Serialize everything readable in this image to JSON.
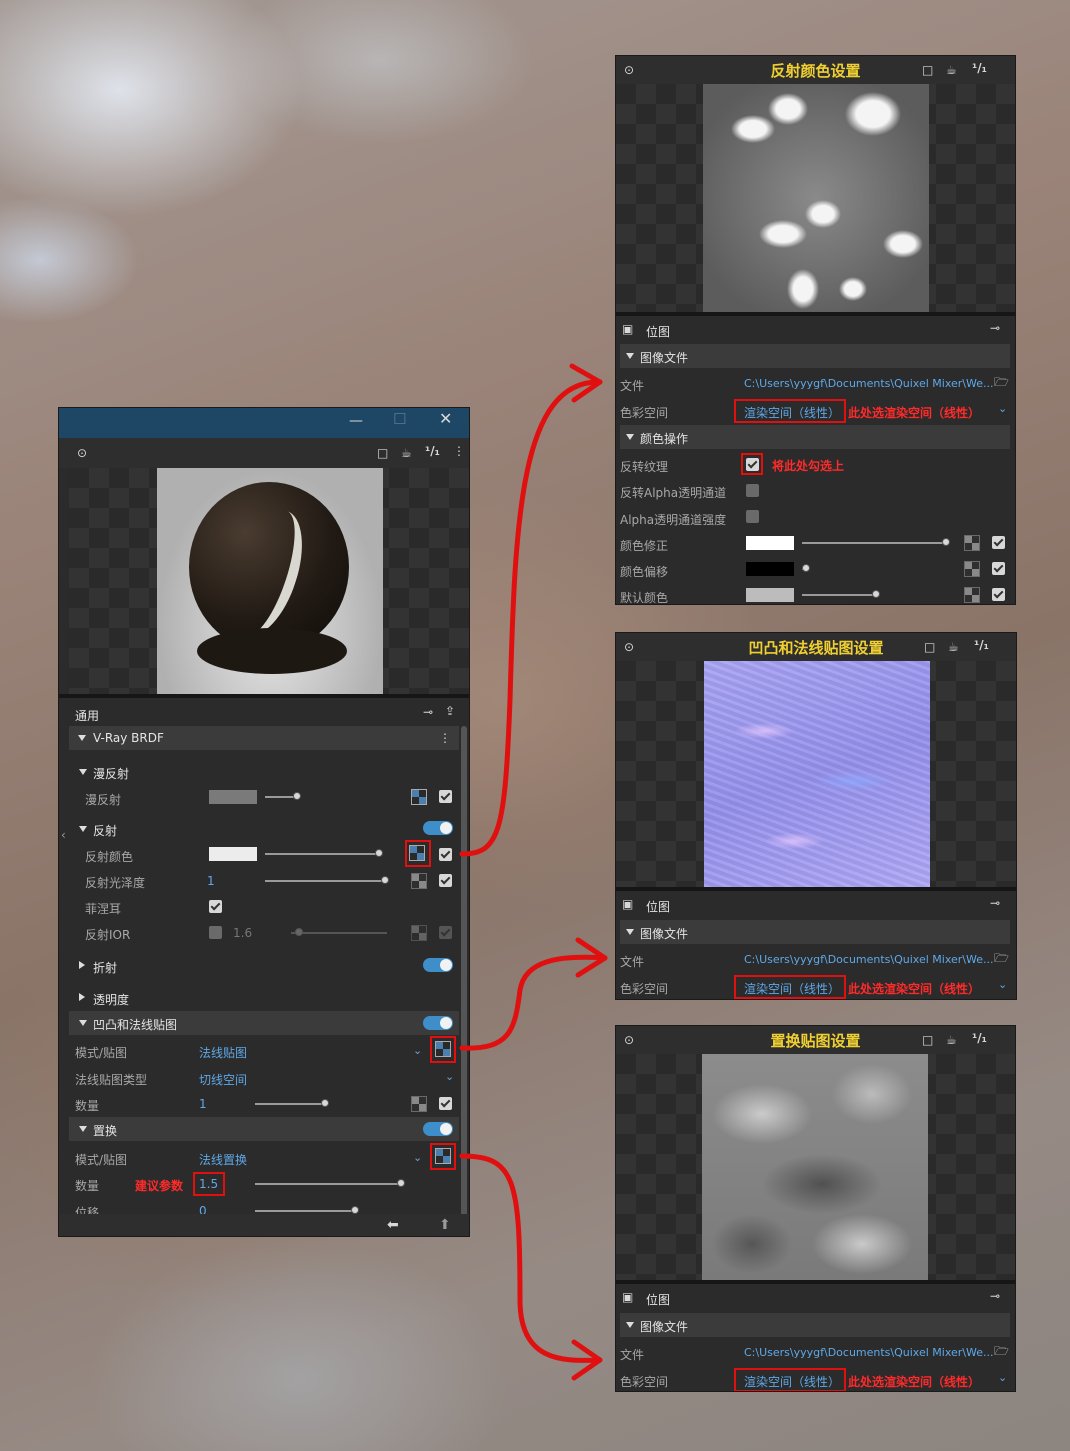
{
  "left_panel": {
    "icons": {
      "pin": "eye-pin-icon",
      "minimize": "minimize-icon",
      "maximize": "maximize-icon",
      "close": "close-icon",
      "render_region": "square-icon",
      "teapot": "teapot-icon",
      "ratio": "1/1",
      "more": "more-icon"
    },
    "ratio_label": "¹/₁",
    "general_label": "通用",
    "brdf_label": "V-Ray BRDF",
    "diffuse_section": "漫反射",
    "diffuse_label": "漫反射",
    "reflection_section": "反射",
    "reflect_color_label": "反射颜色",
    "reflect_gloss_label": "反射光泽度",
    "reflect_gloss_value": "1",
    "fresnel_label": "菲涅耳",
    "reflect_ior_label": "反射IOR",
    "reflect_ior_value": "1.6",
    "refraction_section": "折射",
    "opacity_section": "透明度",
    "bump_section": "凹凸和法线贴图",
    "bump_mode_label": "模式/贴图",
    "bump_mode_value": "法线贴图",
    "normal_type_label": "法线贴图类型",
    "normal_type_value": "切线空间",
    "bump_amount_label": "数量",
    "bump_amount_value": "1",
    "displace_section": "置换",
    "displace_mode_label": "模式/贴图",
    "displace_mode_value": "法线置换",
    "displace_amount_label": "数量",
    "displace_suggest": "建议参数",
    "displace_amount_value": "1.5",
    "displace_shift_label": "位移",
    "displace_shift_value": "0"
  },
  "panel_reflect": {
    "title": "反射颜色设置",
    "bitmap_label": "位图",
    "image_file_section": "图像文件",
    "file_label": "文件",
    "file_path": "C:\\Users\\yyygf\\Documents\\Quixel Mixer\\We...",
    "colorspace_label": "色彩空间",
    "colorspace_value": "渲染空间（线性）",
    "colorspace_note": "此处选渲染空间（线性）",
    "color_ops_section": "颜色操作",
    "invert_label": "反转纹理",
    "invert_note": "将此处勾选上",
    "invert_alpha_label": "反转Alpha透明通道",
    "alpha_strength_label": "Alpha透明通道强度",
    "color_correct_label": "颜色修正",
    "color_offset_label": "颜色偏移",
    "default_color_label": "默认颜色"
  },
  "panel_bump": {
    "title": "凹凸和法线贴图设置",
    "bitmap_label": "位图",
    "image_file_section": "图像文件",
    "file_label": "文件",
    "file_path": "C:\\Users\\yyygf\\Documents\\Quixel Mixer\\We...",
    "colorspace_label": "色彩空间",
    "colorspace_value": "渲染空间（线性）",
    "colorspace_note": "此处选渲染空间（线性）"
  },
  "panel_displace": {
    "title": "置换贴图设置",
    "bitmap_label": "位图",
    "image_file_section": "图像文件",
    "file_label": "文件",
    "file_path": "C:\\Users\\yyygf\\Documents\\Quixel Mixer\\We...",
    "colorspace_label": "色彩空间",
    "colorspace_value": "渲染空间（线性）",
    "colorspace_note": "此处选渲染空间（线性）"
  },
  "colors": {
    "accent_title": "#f0d030",
    "annotation_red": "#e01010",
    "link_blue": "#5fa8e8",
    "toggle_blue": "#3e8ec9",
    "titlebar": "#1e4766"
  }
}
